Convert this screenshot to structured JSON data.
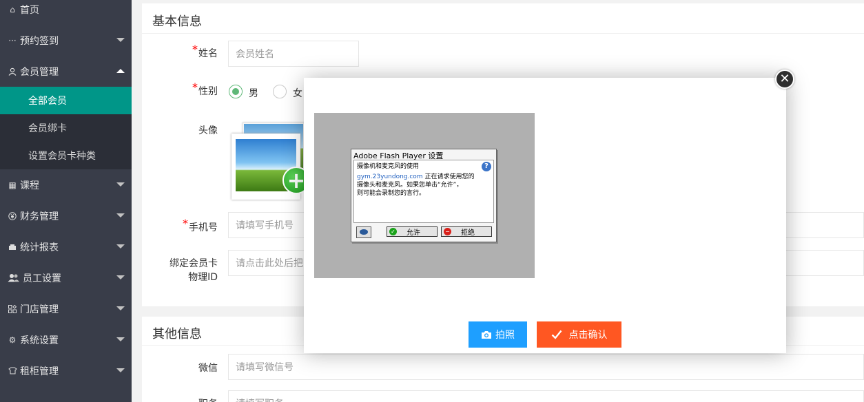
{
  "sidebar": {
    "items": [
      {
        "label": "首页",
        "icon": "home-icon"
      },
      {
        "label": "预约签到",
        "icon": "ellipsis-icon"
      },
      {
        "label": "会员管理",
        "icon": "user-icon"
      },
      {
        "label": "课程",
        "icon": "grid-icon"
      },
      {
        "label": "财务管理",
        "icon": "yen-icon"
      },
      {
        "label": "统计报表",
        "icon": "chart-icon"
      },
      {
        "label": "员工设置",
        "icon": "users-icon"
      },
      {
        "label": "门店管理",
        "icon": "apps-icon"
      },
      {
        "label": "系统设置",
        "icon": "gear-icon"
      },
      {
        "label": "租柜管理",
        "icon": "cabinet-icon"
      }
    ],
    "sub_items": [
      {
        "label": "全部会员",
        "active": true
      },
      {
        "label": "会员绑卡",
        "active": false
      },
      {
        "label": "设置会员卡种类",
        "active": false
      }
    ],
    "active_color": "#009688"
  },
  "basic_info": {
    "title": "基本信息",
    "name_label": "姓名",
    "name_placeholder": "会员姓名",
    "gender_label": "性别",
    "gender_male": "男",
    "gender_female": "女",
    "avatar_label": "头像",
    "phone_label": "手机号",
    "phone_placeholder": "请填写手机号",
    "card_label_line1": "绑定会员卡",
    "card_label_line2": "物理ID",
    "card_placeholder": "请点击此处后把"
  },
  "other_info": {
    "title": "其他信息",
    "wechat_label": "微信",
    "wechat_placeholder": "请填写微信号",
    "job_label": "职务",
    "job_placeholder": "请填写职务"
  },
  "modal": {
    "close_symbol": "✕",
    "flash_title": "Adobe Flash Player 设置",
    "flash_heading": "摄像机和麦克风的使用",
    "flash_domain": "gym.23yundong.com",
    "flash_text_1": " 正在请求使用您的",
    "flash_text_2": "摄像头和麦克风。如果您单击“允许”，",
    "flash_text_3": "则可能会录制您的言行。",
    "flash_allow": "允许",
    "flash_deny": "拒绝",
    "help_symbol": "?",
    "photo_button": "拍照",
    "confirm_button": "点击确认",
    "photo_button_color": "#1e9fff",
    "confirm_button_color": "#ff5722"
  }
}
